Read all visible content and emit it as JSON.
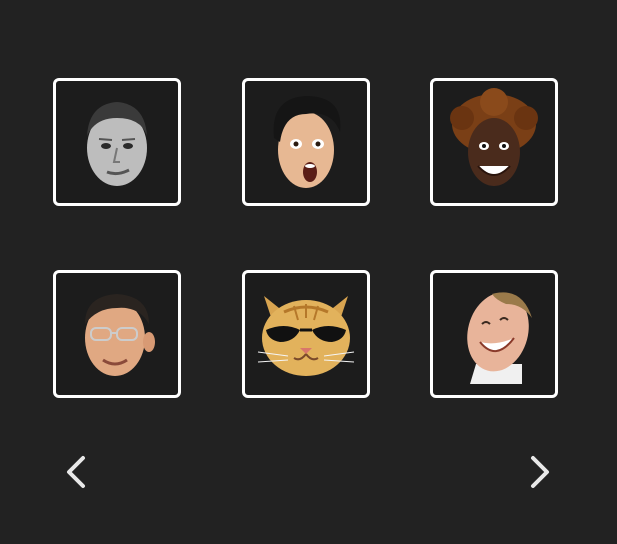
{
  "colors": {
    "background": "#222222",
    "tile_border": "#ffffff",
    "tile_fill": "#1c1c1c",
    "arrow": "#e8e8e8"
  },
  "emotes": [
    {
      "icon": "kappa-face-icon"
    },
    {
      "icon": "pogchamp-face-icon"
    },
    {
      "icon": "trihard-face-icon"
    },
    {
      "icon": "glasses-man-face-icon"
    },
    {
      "icon": "sunglasses-cat-face-icon"
    },
    {
      "icon": "laughing-man-face-icon"
    }
  ],
  "navigation": {
    "prev_icon": "chevron-left-icon",
    "next_icon": "chevron-right-icon"
  }
}
